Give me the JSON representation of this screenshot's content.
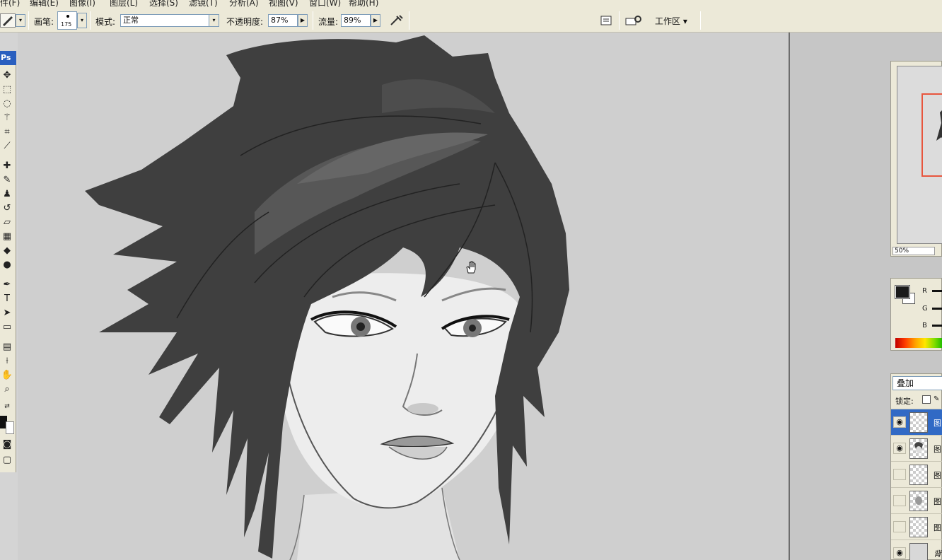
{
  "menu": {
    "items": [
      "件(F)",
      "编辑(E)",
      "图像(I)",
      "图层(L)",
      "选择(S)",
      "滤镜(T)",
      "分析(A)",
      "视图(V)",
      "窗口(W)",
      "帮助(H)"
    ]
  },
  "options": {
    "brush_label": "画笔:",
    "brush_size": "175",
    "mode_label": "模式:",
    "mode_value": "正常",
    "opacity_label": "不透明度:",
    "opacity_value": "87%",
    "flow_label": "流量:",
    "flow_value": "89%",
    "workspace_label": "工作区 ▾"
  },
  "toolbox": {
    "badge": "Ps",
    "tools": [
      "move-tool",
      "marquee-tool",
      "lasso-tool",
      "magic-wand-tool",
      "crop-tool",
      "slice-tool",
      "healing-brush-tool",
      "brush-tool",
      "clone-stamp-tool",
      "history-brush-tool",
      "eraser-tool",
      "gradient-tool",
      "blur-tool",
      "dodge-tool",
      "pen-tool",
      "type-tool",
      "path-selection-tool",
      "shape-tool",
      "notes-tool",
      "eyedropper-tool",
      "hand-tool",
      "zoom-tool"
    ]
  },
  "navigator": {
    "zoom": "50%"
  },
  "color_panel": {
    "r_label": "R",
    "g_label": "G",
    "b_label": "B",
    "foreground": "#1a1a1a",
    "background": "#ffffff"
  },
  "layers_panel": {
    "blend_mode": "叠加",
    "lock_label": "锁定:",
    "layers": [
      {
        "name": "图",
        "visible": true,
        "selected": true
      },
      {
        "name": "图",
        "visible": true,
        "selected": false
      },
      {
        "name": "图",
        "visible": false,
        "selected": false
      },
      {
        "name": "图",
        "visible": false,
        "selected": false
      },
      {
        "name": "图",
        "visible": false,
        "selected": false
      },
      {
        "name": "背",
        "visible": true,
        "selected": false
      }
    ]
  },
  "colors": {
    "accent": "#2a5fbf",
    "nav_frame": "#e8553d",
    "panel_bg": "#ece9d8"
  }
}
